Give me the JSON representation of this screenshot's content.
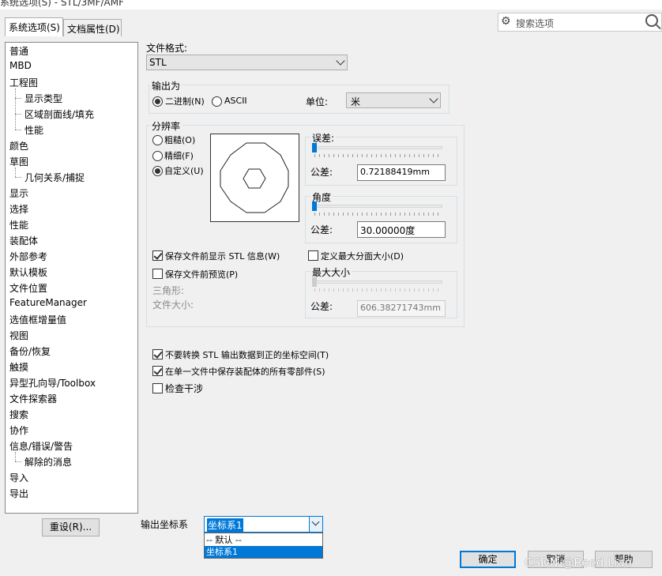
{
  "window": {
    "title_fragment": "系统选项(S) - STL/3MF/AMF"
  },
  "tabs": [
    {
      "label": "系统选项(S)"
    },
    {
      "label": "文档属性(D)"
    }
  ],
  "search": {
    "placeholder": "搜索选项"
  },
  "sidebar": {
    "items": [
      {
        "label": "普通"
      },
      {
        "label": "MBD"
      },
      {
        "label": "工程图"
      },
      {
        "label": "显示类型"
      },
      {
        "label": "区域剖面线/填充"
      },
      {
        "label": "性能"
      },
      {
        "label": "颜色"
      },
      {
        "label": "草图"
      },
      {
        "label": "几何关系/捕捉"
      },
      {
        "label": "显示"
      },
      {
        "label": "选择"
      },
      {
        "label": "性能"
      },
      {
        "label": "装配体"
      },
      {
        "label": "外部参考"
      },
      {
        "label": "默认模板"
      },
      {
        "label": "文件位置"
      },
      {
        "label": "FeatureManager"
      },
      {
        "label": "选值框增量值"
      },
      {
        "label": "视图"
      },
      {
        "label": "备份/恢复"
      },
      {
        "label": "触摸"
      },
      {
        "label": "异型孔向导/Toolbox"
      },
      {
        "label": "文件探索器"
      },
      {
        "label": "搜索"
      },
      {
        "label": "协作"
      },
      {
        "label": "信息/错误/警告"
      },
      {
        "label": "解除的消息"
      },
      {
        "label": "导入"
      },
      {
        "label": "导出"
      }
    ],
    "reset_button": "重设(R)..."
  },
  "format": {
    "label": "文件格式:",
    "value": "STL"
  },
  "output_as": {
    "title": "输出为",
    "binary": "二进制(N)",
    "ascii": "ASCII",
    "unit_label": "单位:",
    "unit_value": "米",
    "selected": "binary"
  },
  "resolution": {
    "title": "分辨率",
    "coarse": "粗糙(O)",
    "fine": "精细(F)",
    "custom": "自定义(U)",
    "selected": "custom",
    "deviation": {
      "title": "误差:",
      "tol_label": "公差:",
      "value": "0.72188419mm"
    },
    "angle": {
      "title": "角度",
      "tol_label": "公差:",
      "value": "30.00000度"
    },
    "show_info": {
      "label": "保存文件前显示 STL 信息(W)",
      "checked": true
    },
    "preview": {
      "label": "保存文件前预览(P)",
      "checked": false
    },
    "max_facet": {
      "label": "定义最大分面大小(D)",
      "checked": false
    },
    "max_size": {
      "title": "最大大小",
      "tol_label": "公差:",
      "value": "606.38271743mm"
    },
    "triangles_label": "三角形:",
    "filesize_label": "文件大小:"
  },
  "options": [
    {
      "label": "不要转换 STL 输出数据到正的坐标空间(T)",
      "checked": true
    },
    {
      "label": "在单一文件中保存装配体的所有零部件(S)",
      "checked": true
    },
    {
      "label": "检查干涉",
      "checked": false
    }
  ],
  "coord": {
    "label": "输出坐标系",
    "value": "坐标系1",
    "options": [
      "-- 默认 --",
      "坐标系1"
    ],
    "selected_index": 1
  },
  "footer": {
    "ok": "确定",
    "cancel": "取消",
    "help": "帮助"
  },
  "watermark": "CSDN @Reed Liao",
  "colors": {
    "accent": "#0078d7",
    "selection": "#0078d7"
  }
}
